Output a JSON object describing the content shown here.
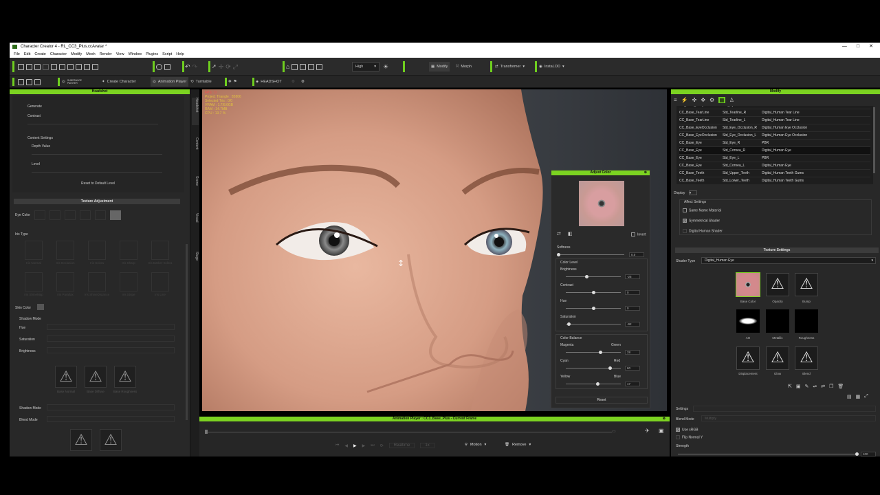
{
  "window": {
    "title": "Character Creator 4 - RL_CC3_Plus.ccAvatar *",
    "controls": [
      "—",
      "□",
      "✕"
    ]
  },
  "menu": [
    "File",
    "Edit",
    "Create",
    "Character",
    "Modify",
    "Mesh",
    "Render",
    "View",
    "Window",
    "Plugins",
    "Script",
    "Help"
  ],
  "toolbar1": {
    "quality": "High",
    "modify": "Modify",
    "morph": "Morph",
    "transformer": "Transformer",
    "installdd": "InstaLOD"
  },
  "toolbar2": {
    "substance": "SUBSTANCE PAINTER",
    "create_character": "Create Character",
    "animation_player": "Animation Player",
    "turntable": "Turntable",
    "headshot": "HEADSHOT"
  },
  "left_panel": {
    "header": "Headshot",
    "section": "Texture Adjustment",
    "faded": [
      "Generate",
      "Contrast",
      "Content Settings",
      "Depth Value",
      "Level",
      "Reset to Default Level",
      "Eye Color",
      "Iris Type",
      "Hue",
      "Saturation",
      "Brightness",
      "Blend",
      "Skin Color",
      "Shadow Mode",
      "Blend Mode"
    ],
    "iris_types": [
      "Iris Normal",
      "Iris Occlusion",
      "Iris Sclera",
      "Iris Sharp",
      "Iris Darker Sclera",
      "Iris ShineMap",
      "Iris Parallax",
      "Iris ShineDistance",
      "Iris Stripe",
      "Iris Line"
    ],
    "tri_labels": [
      "Base Normal",
      "Base Diffuse",
      "Base Roughness"
    ]
  },
  "left_tabs": [
    "Headshot",
    "Content",
    "Scene",
    "Visual",
    "Stage"
  ],
  "viewport": {
    "stats": [
      "FPS : 0",
      "Project Triangle : 85806",
      "Selected Tris : 0/0",
      "VRAM : 1.7/8.0GB",
      "RAM : 14.7MB",
      "CPU : 13.7 %"
    ]
  },
  "adjust_color": {
    "title": "Adjust Color",
    "invert": "Invert",
    "softness": {
      "label": "Softness",
      "value": "0.0"
    },
    "color_level": "Color Level",
    "brightness": {
      "label": "Brightness",
      "value": "-25",
      "frac": 0.38
    },
    "contrast": {
      "label": "Contrast",
      "value": "0",
      "frac": 0.5
    },
    "hue": {
      "label": "Hue",
      "value": "0",
      "frac": 0.5
    },
    "saturation": {
      "label": "Saturation",
      "value": "-92",
      "frac": 0.05
    },
    "color_balance": "Color Balance",
    "magenta": "Magenta",
    "green": "Green",
    "mg_value": "28",
    "mg_frac": 0.62,
    "cyan": "Cyan",
    "red": "Red",
    "cr_value": "60",
    "cr_frac": 0.8,
    "yellow": "Yellow",
    "blue": "Blue",
    "yb_value": "17",
    "yb_frac": 0.58,
    "reset": "Reset"
  },
  "anim": {
    "title": "Animation Player : CC3_Base_Plus - Current Frame",
    "realtime": "Realtime",
    "fps": "1x",
    "motion": "Motion",
    "remove": "Remove"
  },
  "right_panel": {
    "header": "Modify",
    "materials": [
      [
        "CC_Base_Body",
        "Std_Eyelash",
        "PBR"
      ],
      [
        "CC_Base_TearLine",
        "Std_Tearline_R",
        "Digital_Human Tear Line"
      ],
      [
        "CC_Base_TearLine",
        "Std_Tearline_L",
        "Digital_Human Tear Line"
      ],
      [
        "CC_Base_EyeOcclusion",
        "Std_Eye_Occlusion_R",
        "Digital_Human Eye Occlusion"
      ],
      [
        "CC_Base_EyeOcclusion",
        "Std_Eye_Occlusion_L",
        "Digital_Human Eye Occlusion"
      ],
      [
        "CC_Base_Eye",
        "Std_Eye_R",
        "PBR"
      ],
      [
        "CC_Base_Eye",
        "Std_Cornea_R",
        "Digital_Human Eye"
      ],
      [
        "CC_Base_Eye",
        "Std_Eye_L",
        "PBR"
      ],
      [
        "CC_Base_Eye",
        "Std_Cornea_L",
        "Digital_Human Eye"
      ],
      [
        "CC_Base_Teeth",
        "Std_Upper_Teeth",
        "Digital_Human Teeth Gums"
      ],
      [
        "CC_Base_Teeth",
        "Std_Lower_Teeth",
        "Digital_Human Teeth Gums"
      ]
    ],
    "display": "Display",
    "affect_settings": "Affect Settings",
    "same_name": "Same Name Material",
    "symmetrical": "Symmetrical Shader",
    "digital_human_shader": "Digital Human Shader",
    "texture_settings": "Texture Settings",
    "shader_type_label": "Shader Type",
    "shader_type": "Digital_Human Eye",
    "slots": [
      "Base Color",
      "Opacity",
      "Bump",
      "AO",
      "Metallic",
      "Roughness",
      "Displacement",
      "Glow",
      "Blend"
    ],
    "use_srgb": "Use sRGB",
    "flip_normal": "Flip Normal Y",
    "strength": "Strength",
    "strength_value": "100",
    "strength_frac": 1.0,
    "blend_mode_label": "Blend Mode",
    "blend_mode": "Multiply",
    "settings": "Settings"
  }
}
